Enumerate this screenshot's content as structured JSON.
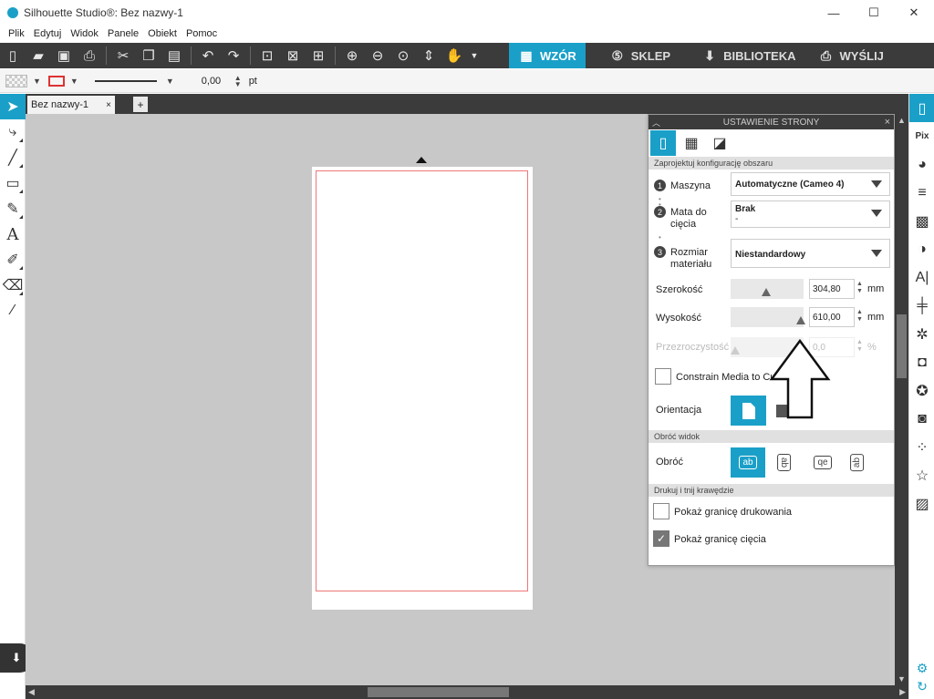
{
  "window": {
    "title": "Silhouette Studio®: Bez nazwy-1",
    "controls": {
      "minimize": "—",
      "maximize": "☐",
      "close": "✕"
    }
  },
  "menu": [
    "Plik",
    "Edytuj",
    "Widok",
    "Panele",
    "Obiekt",
    "Pomoc"
  ],
  "toolbar": {
    "tabs": [
      {
        "label": "WZÓR",
        "active": true,
        "icon": "grid-icon"
      },
      {
        "label": "SKLEP",
        "active": false,
        "icon": "s-logo-icon"
      },
      {
        "label": "BIBLIOTEKA",
        "active": false,
        "icon": "download-icon"
      },
      {
        "label": "WYŚLIJ",
        "active": false,
        "icon": "printer-icon"
      }
    ]
  },
  "properties": {
    "line_width_value": "0,00",
    "line_width_unit": "pt"
  },
  "document": {
    "tab_title": "Bez nazwy-1",
    "tab_close": "×",
    "add_tab": "+"
  },
  "dialog": {
    "title": "USTAWIENIE STRONY",
    "section_area": "Zaprojektuj konfigurację obszaru",
    "machine_label": "Maszyna",
    "machine_value": "Automatyczne (Cameo 4)",
    "mat_label_1": "Mata do",
    "mat_label_2": "cięcia",
    "mat_value": "Brak",
    "mat_sub": "-",
    "material_label_1": "Rozmiar",
    "material_label_2": "materiału",
    "material_value": "Niestandardowy",
    "width_label": "Szerokość",
    "width_value": "304,80",
    "width_unit": "mm",
    "height_label": "Wysokość",
    "height_value": "610,00",
    "height_unit": "mm",
    "opacity_label": "Przezroczystość",
    "opacity_value": "0,0",
    "opacity_unit": "%",
    "constrain_label": "Constrain Media to Cutting Mat",
    "orientation_label": "Orientacja",
    "section_view": "Obróć widok",
    "rotate_label": "Obróć",
    "flip_options": [
      "ab",
      "ab",
      "qe",
      "ab"
    ],
    "section_print": "Drukuj i tnij krawędzie",
    "show_print_border": "Pokaż granicę drukowania",
    "show_cut_border": "Pokaż granicę cięcia",
    "show_print_border_checked": false,
    "show_cut_border_checked": true,
    "constrain_checked": false
  },
  "colors": {
    "accent": "#1aa0c8",
    "toolbar_bg": "#3b3b3b",
    "canvas_bg": "#c8c8c8",
    "cut_border": "#e77777"
  }
}
